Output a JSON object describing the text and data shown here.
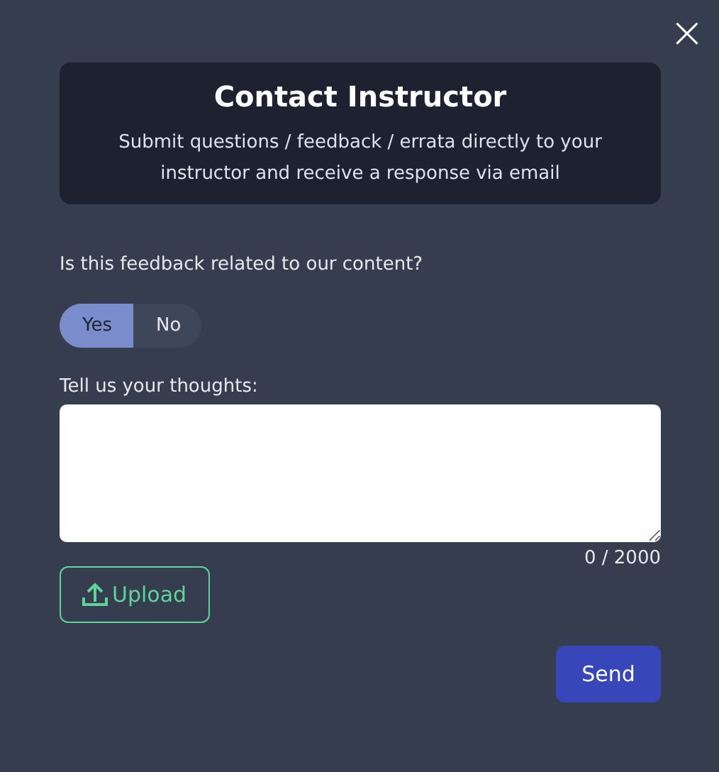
{
  "close_button": {
    "label": "×"
  },
  "header": {
    "title": "Contact Instructor",
    "subtitle": "Submit questions / feedback / errata directly to your instructor and receive a response via email"
  },
  "question": {
    "label": "Is this feedback related to our content?"
  },
  "options": [
    {
      "label": "Yes",
      "selected": true
    },
    {
      "label": "No",
      "selected": false
    }
  ],
  "thoughts": {
    "label": "Tell us your thoughts:",
    "counter": "0 / 2000"
  },
  "upload_button": {
    "label": "Upload"
  },
  "send_button": {
    "label": "Send"
  }
}
